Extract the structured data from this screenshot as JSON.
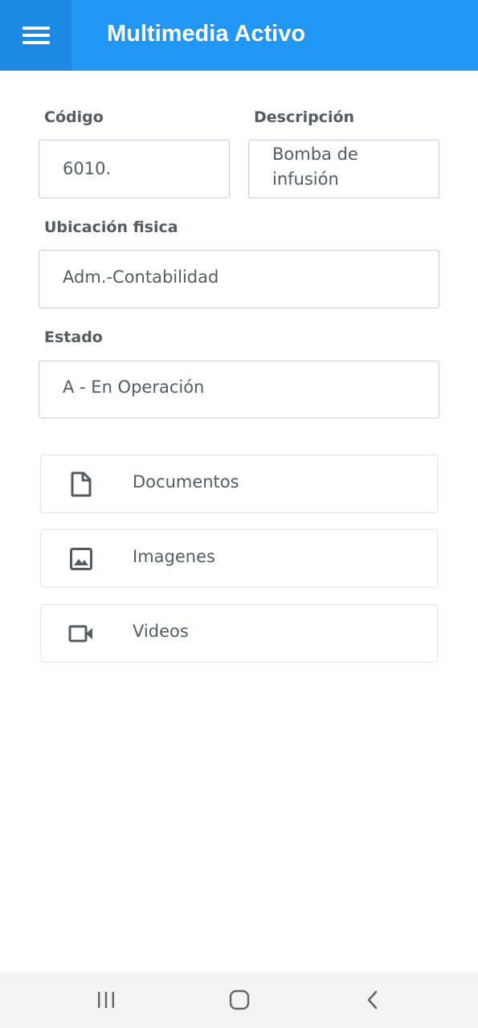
{
  "appbar": {
    "title": "Multimedia Activo",
    "menu_icon": "hamburger-menu-icon",
    "color": "#2196f3"
  },
  "form": {
    "codigo": {
      "label": "Código",
      "value": "6010."
    },
    "descripcion": {
      "label": "Descripción",
      "value_line1": "Bomba de",
      "value_line2": "infusión"
    },
    "ubicacion": {
      "label": "Ubicación fisica",
      "value": "Adm.-Contabilidad"
    },
    "estado": {
      "label": "Estado",
      "value": "A - En Operación"
    }
  },
  "actions": [
    {
      "label": "Documentos",
      "icon": "document-icon"
    },
    {
      "label": "Imagenes",
      "icon": "image-icon"
    },
    {
      "label": "Videos",
      "icon": "video-camera-icon"
    }
  ],
  "system_nav": {
    "recents_icon": "recents-icon",
    "home_icon": "home-icon",
    "back_icon": "back-icon"
  }
}
